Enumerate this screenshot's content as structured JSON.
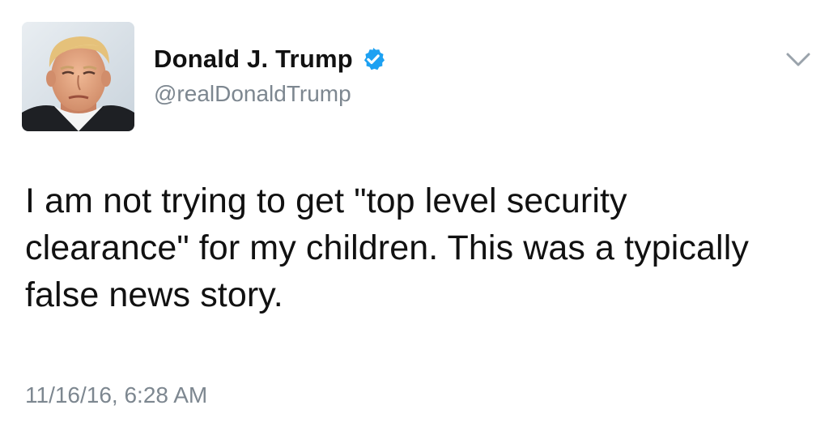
{
  "tweet": {
    "author": {
      "display_name": "Donald J. Trump",
      "handle": "@realDonaldTrump",
      "verified": true,
      "verified_icon": "verified-badge-icon",
      "avatar_icon": "profile-photo"
    },
    "text": "I am not trying to get \"top level security clearance\" for my children. This was a typically false news story.",
    "timestamp": "11/16/16, 6:28 AM",
    "menu_icon": "chevron-down-icon"
  },
  "colors": {
    "text": "#111111",
    "muted": "#7d8790",
    "verified_blue": "#1da1f2",
    "background": "#ffffff"
  }
}
